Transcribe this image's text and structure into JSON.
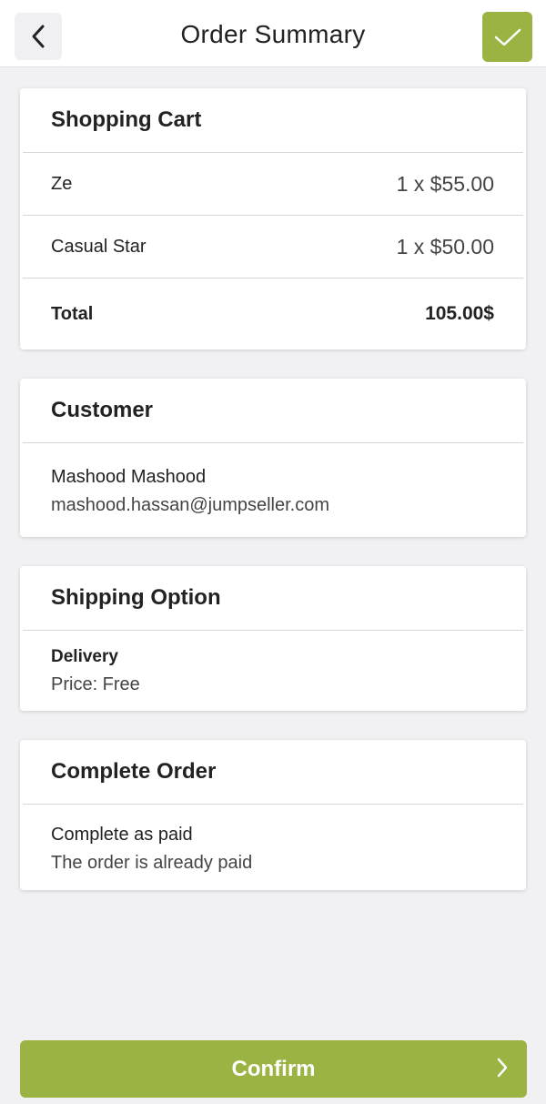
{
  "header": {
    "title": "Order Summary",
    "back_icon": "chevron-left-icon",
    "confirm_icon": "checkmark-icon"
  },
  "colors": {
    "accent": "#9ab342",
    "background": "#f1f1f3"
  },
  "cart": {
    "heading": "Shopping Cart",
    "items": [
      {
        "name": "Ze",
        "qty_price": "1 x $55.00"
      },
      {
        "name": "Casual Star",
        "qty_price": "1 x $50.00"
      }
    ],
    "total_label": "Total",
    "total_value": "105.00$"
  },
  "customer": {
    "heading": "Customer",
    "name": "Mashood Mashood",
    "email": "mashood.hassan@jumpseller.com"
  },
  "shipping": {
    "heading": "Shipping Option",
    "method": "Delivery",
    "price": "Price: Free"
  },
  "complete": {
    "heading": "Complete Order",
    "option": "Complete as paid",
    "description": "The order is already paid"
  },
  "footer": {
    "confirm_label": "Confirm",
    "confirm_icon": "chevron-right-icon"
  }
}
